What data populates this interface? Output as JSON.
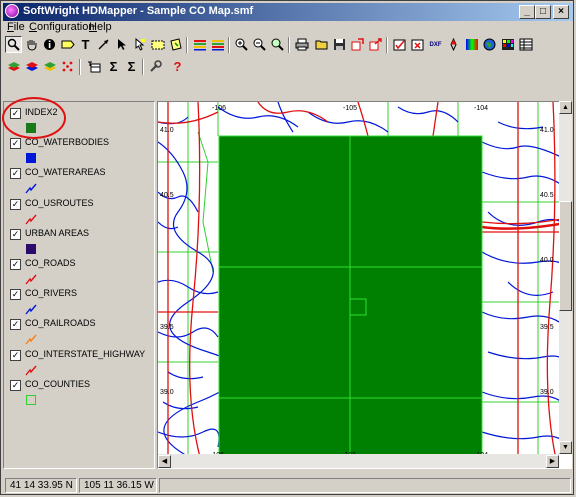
{
  "window": {
    "title": "SoftWright HDMapper - Sample CO Map.smf",
    "controls": {
      "minimize": "_",
      "maximize": "□",
      "close": "×"
    }
  },
  "menu": [
    {
      "label": "File"
    },
    {
      "label": "Configuration"
    },
    {
      "label": "Help"
    }
  ],
  "toolbar_row1_icons": [
    "zoom-magnifier",
    "pan-hand",
    "info",
    "label-tool",
    "text-tool",
    "line-tool",
    "pointer",
    "select-tool",
    "select-area",
    "select-poly",
    "layers-a",
    "layers-b",
    "zoom-in",
    "zoom-out",
    "zoom-full",
    "print",
    "open-folder",
    "save",
    "export-a",
    "export-b",
    "edit-a",
    "edit-b",
    "dxf-export",
    "compass",
    "color-map",
    "globe",
    "grid",
    "table"
  ],
  "toolbar_row2_icons": [
    "layer-add",
    "layer-remove",
    "layer-props",
    "points",
    "table-view",
    "sum",
    "sum-selected",
    "settings",
    "help"
  ],
  "toolbar_text": {
    "text_tool": "T",
    "dxf": "DXF",
    "sum": "Σ",
    "help": "?"
  },
  "layers": [
    {
      "name": "INDEX2",
      "checked": true,
      "symbol": "fill",
      "color": "#1a7a1a"
    },
    {
      "name": "CO_WATERBODIES",
      "checked": true,
      "symbol": "fill",
      "color": "#0018d8"
    },
    {
      "name": "CO_WATERAREAS",
      "checked": true,
      "symbol": "line",
      "color": "#0018d8"
    },
    {
      "name": "CO_USROUTES",
      "checked": true,
      "symbol": "line",
      "color": "#e01010"
    },
    {
      "name": "URBAN AREAS",
      "checked": true,
      "symbol": "fill",
      "color": "#2a0a6a"
    },
    {
      "name": "CO_ROADS",
      "checked": true,
      "symbol": "line",
      "color": "#e01010"
    },
    {
      "name": "CO_RIVERS",
      "checked": true,
      "symbol": "line",
      "color": "#0018d8"
    },
    {
      "name": "CO_RAILROADS",
      "checked": true,
      "symbol": "line",
      "color": "#f08020"
    },
    {
      "name": "CO_INTERSTATE_HIGHWAY",
      "checked": true,
      "symbol": "line",
      "color": "#e01010"
    },
    {
      "name": "CO_COUNTIES",
      "checked": true,
      "symbol": "outline",
      "color": "#30d030"
    }
  ],
  "map": {
    "top_labels": [
      "-106",
      "-105",
      "-104"
    ],
    "bottom_labels": [
      "-106",
      "-106",
      "-104"
    ],
    "left_labels": [
      "41.0",
      "40.5",
      "39.5",
      "39.0"
    ],
    "right_labels": [
      "41.0",
      "40.5",
      "40.0",
      "39.5",
      "39.0"
    ],
    "colors": {
      "index_fill": "#008000",
      "grid": "#30e030",
      "rivers": "#0018d8",
      "roads": "#e01010",
      "counties": "#30d030"
    }
  },
  "status": {
    "lat": "41 14 33.95 N",
    "lon": "105 11 36.15 W"
  }
}
